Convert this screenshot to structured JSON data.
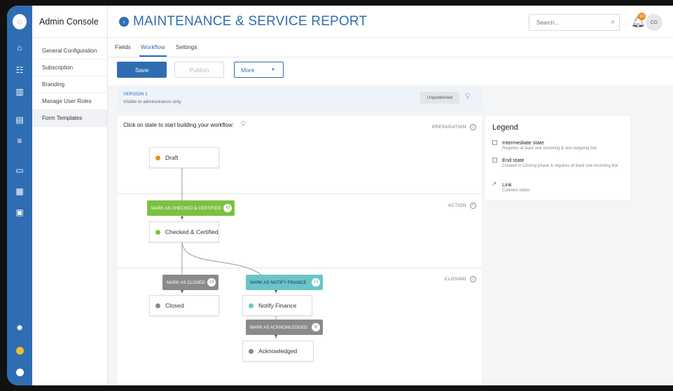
{
  "app": {
    "name": "Admin Console",
    "logo_icon": "app-logo-icon"
  },
  "rail": {
    "icons": [
      "home-icon",
      "users-icon",
      "building-icon",
      "document-icon",
      "list-icon",
      "monitor-icon",
      "calendar-icon",
      "report-icon",
      "settings-icon",
      "help-icon",
      "power-icon"
    ]
  },
  "sidebar": {
    "items": [
      {
        "label": "General Configuration"
      },
      {
        "label": "Subscription"
      },
      {
        "label": "Branding"
      },
      {
        "label": "Manage User Roles"
      },
      {
        "label": "Form Templates",
        "active": true
      }
    ]
  },
  "header": {
    "title": "MAINTENANCE & SERVICE REPORT",
    "search_placeholder": "Search...",
    "notification_count": "10",
    "user_initials": "CG"
  },
  "tabs": [
    {
      "label": "Fields"
    },
    {
      "label": "Workflow",
      "active": true
    },
    {
      "label": "Settings"
    }
  ],
  "toolbar": {
    "save": "Save",
    "publish": "Publish",
    "more": "More"
  },
  "version": {
    "title": "VERSION 1",
    "subtitle": "Visible to administrators only",
    "status": "Unpublished"
  },
  "workflow": {
    "hint": "Click on state to start building your workflow:",
    "phases": [
      "PREPARATION",
      "ACTION",
      "CLOSING"
    ],
    "states": {
      "draft": "Draft",
      "checked": "Checked & Certified",
      "closed": "Closed",
      "notify": "Notify Finance",
      "acknowledged": "Acknowledged"
    },
    "actions": {
      "certify": {
        "label": "MARK AS CHECKED & CERTIFIED",
        "chip": "All"
      },
      "close": {
        "label": "MARK AS CLOSED",
        "chip": "All"
      },
      "notify": {
        "label": "MARK AS NOTIFY FINANCE",
        "chip": "All"
      },
      "acknowledge": {
        "label": "MARK AS ACKNOWLEDGED",
        "chip": "M"
      }
    },
    "colors": {
      "draft": "#f08c1d",
      "checked": "#7bc142",
      "closed": "#8a8a8a",
      "notify": "#69c5c9",
      "acknowledged": "#8a8a8a",
      "action_green": "#7bc142",
      "action_gray": "#8a8a8a",
      "action_teal": "#69c5c9"
    }
  },
  "legend": {
    "title": "Legend",
    "items": [
      {
        "name": "Intermediate state",
        "desc": "Requires at least one incoming & one outgoing link"
      },
      {
        "name": "End state",
        "desc": "Created in Closing phase & requires at least one incoming link"
      },
      {
        "name": "Link",
        "desc": "Connect states"
      }
    ]
  }
}
